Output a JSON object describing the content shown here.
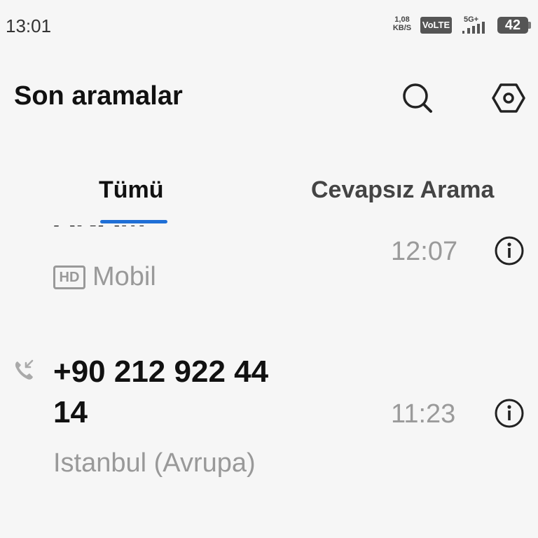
{
  "status_bar": {
    "time": "13:01",
    "net_speed_value": "1,08",
    "net_speed_unit": "KB/S",
    "volte": "VoLTE",
    "network": "5G+",
    "battery": "42"
  },
  "header": {
    "title": "Son aramalar",
    "search_icon": "search-icon",
    "settings_icon": "gear-icon"
  },
  "tabs": [
    {
      "label": "Tümü",
      "selected": true
    },
    {
      "label": "Cevapsız Arama",
      "selected": false
    }
  ],
  "accent_color": "#1f6fd6",
  "calls": [
    {
      "name": "ANAM",
      "time": "12:07",
      "badge": "HD",
      "subtitle": "Mobil"
    },
    {
      "name_line1": "+90 212 922 44",
      "name_line2": "14",
      "time": "11:23",
      "subtitle": "Istanbul (Avrupa)",
      "type_icon": "incoming-call-icon"
    }
  ]
}
